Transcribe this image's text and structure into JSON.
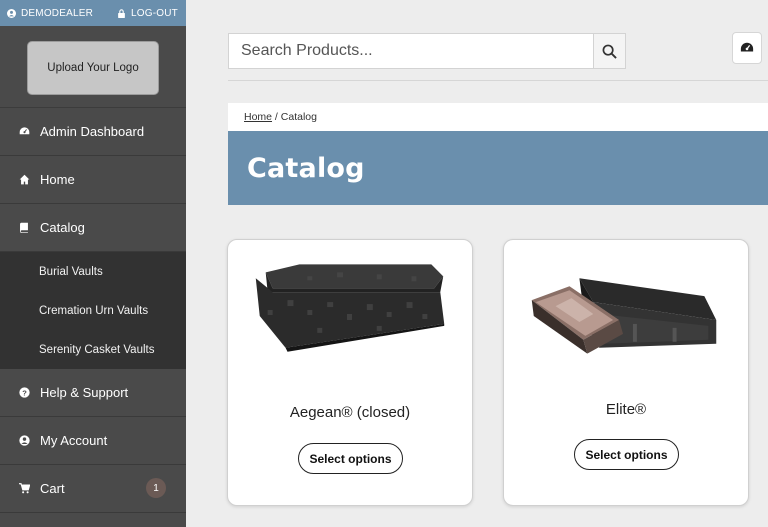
{
  "topbar": {
    "user": "DEMODEALER",
    "logout": "LOG-OUT"
  },
  "sidebar": {
    "logo_button": "Upload Your Logo",
    "items": [
      {
        "label": "Admin Dashboard",
        "icon": "dashboard-icon"
      },
      {
        "label": "Home",
        "icon": "home-icon"
      },
      {
        "label": "Catalog",
        "icon": "book-icon"
      },
      {
        "label": "Help & Support",
        "icon": "question-icon"
      },
      {
        "label": "My Account",
        "icon": "user-icon"
      },
      {
        "label": "Cart",
        "icon": "cart-icon",
        "badge": "1"
      }
    ],
    "catalog_sub": [
      "Burial Vaults",
      "Cremation Urn Vaults",
      "Serenity Casket Vaults"
    ]
  },
  "search": {
    "placeholder": "Search Products..."
  },
  "breadcrumb": {
    "home": "Home",
    "separator": " / ",
    "current": "Catalog"
  },
  "page_title": "Catalog",
  "products": [
    {
      "name": "Aegean® (closed)",
      "button": "Select options"
    },
    {
      "name": "Elite®",
      "button": "Select options"
    }
  ],
  "colors": {
    "accent": "#6a8fad",
    "sidebar": "#4a4a4a",
    "sidebar_sub": "#323232",
    "badge": "#6b5a55"
  }
}
